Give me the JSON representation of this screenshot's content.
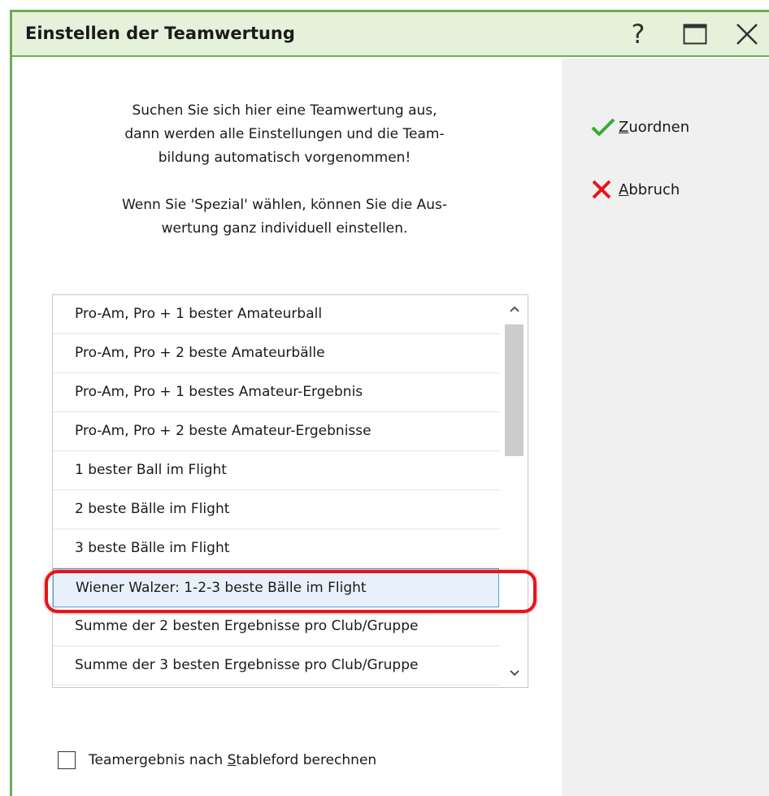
{
  "window": {
    "title": "Einstellen der Teamwertung",
    "help_label": "?"
  },
  "intro": {
    "lines": [
      "Suchen Sie sich hier eine Teamwertung aus,",
      "dann werden alle Einstellungen und die Team-",
      "bildung automatisch vorgenommen!",
      "Wenn Sie 'Spezial' wählen, können Sie die Aus-",
      "wertung ganz individuell einstellen."
    ]
  },
  "list": {
    "items": [
      "Pro-Am, Pro + 1 bester Amateurball",
      "Pro-Am, Pro + 2 beste Amateurbälle",
      "Pro-Am, Pro + 1 bestes Amateur-Ergebnis",
      "Pro-Am, Pro + 2 beste Amateur-Ergebnisse",
      "1 bester Ball im Flight",
      "2 beste Bälle im Flight",
      "3 beste Bälle im Flight",
      "Wiener Walzer: 1-2-3 beste Bälle im Flight",
      "Summe der 2 besten Ergebnisse pro Club/Gruppe",
      "Summe der 3 besten Ergebnisse pro Club/Gruppe"
    ],
    "selected_index": 7
  },
  "checkbox": {
    "label_pre": "Teamergebnis nach ",
    "label_mnemonic": "S",
    "label_post": "tableford berechnen",
    "checked": false
  },
  "actions": {
    "assign": {
      "mnemonic": "Z",
      "rest": "uordnen",
      "icon": "checkmark-icon",
      "color": "#3aa935"
    },
    "cancel": {
      "mnemonic": "A",
      "rest": "bbruch",
      "icon": "close-x-icon",
      "color": "#e4161b"
    }
  },
  "colors": {
    "titlebar_bg": "#e6f1dc",
    "frame": "#6ab04c",
    "highlight": "#e4161b",
    "selection_border": "#5b9bd5"
  }
}
